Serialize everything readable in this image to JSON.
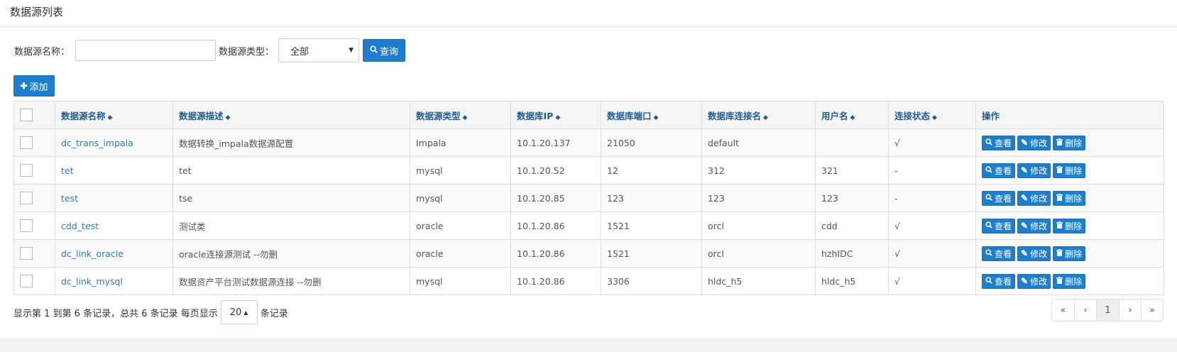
{
  "page": {
    "title": "数据源列表"
  },
  "search": {
    "name_label": "数据源名称：",
    "name_value": "",
    "type_label": "数据源类型：",
    "type_selected": "全部",
    "query_label": "查询",
    "add_label": "添加"
  },
  "table": {
    "headers": [
      "数据源名称",
      "数据源描述",
      "数据源类型",
      "数据库IP",
      "数据库端口",
      "数据库连接名",
      "用户名",
      "连接状态",
      "操作"
    ],
    "rows": [
      [
        "dc_trans_impala",
        "数据转换_impala数据源配置",
        "Impala",
        "10.1.20.137",
        "21050",
        "default",
        "",
        "√"
      ],
      [
        "tet",
        "tet",
        "mysql",
        "10.1.20.52",
        "12",
        "312",
        "321",
        "-"
      ],
      [
        "test",
        "tse",
        "mysql",
        "10.1.20.85",
        "123",
        "123",
        "123",
        "-"
      ],
      [
        "cdd_test",
        "测试类",
        "oracle",
        "10.1.20.86",
        "1521",
        "orcl",
        "cdd",
        "√"
      ],
      [
        "dc_link_oracle",
        "oracle连接源测试 --勿删",
        "oracle",
        "10.1.20.86",
        "1521",
        "orcl",
        "hzhIDC",
        "√"
      ],
      [
        "dc_link_mysql",
        "数据资产平台测试数据源连接 --勿删",
        "mysql",
        "10.1.20.86",
        "3306",
        "hldc_h5",
        "hldc_h5",
        "√"
      ]
    ],
    "actions": {
      "view": "查看",
      "edit": "修改",
      "delete": "删除"
    }
  },
  "footer": {
    "info_prefix": "显示第 1 到第 6 条记录，总共 6 条记录 每页显示",
    "page_size": "20",
    "info_suffix": "条记录"
  },
  "pager": {
    "first": "«",
    "prev": "‹",
    "current": "1",
    "next": "›",
    "last": "»"
  },
  "colors": {
    "primary": "#1e7ecb",
    "header_text": "#1e5c92",
    "link": "#337ab7"
  }
}
